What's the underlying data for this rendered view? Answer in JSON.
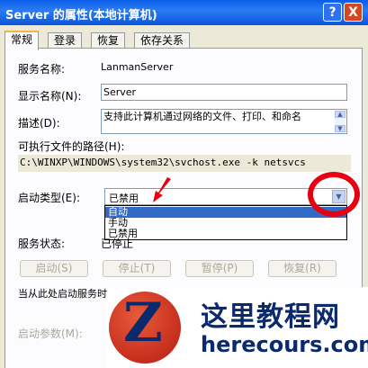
{
  "window": {
    "title": "Server 的属性(本地计算机)",
    "help_label": "?",
    "close_label": "X"
  },
  "tabs": [
    "常规",
    "登录",
    "恢复",
    "依存关系"
  ],
  "general": {
    "service_name_label": "服务名称:",
    "service_name_value": "LanmanServer",
    "display_name_label": "显示名称(N):",
    "display_name_value": "Server",
    "description_label": "描述(D):",
    "description_value": "支持此计算机通过网络的文件、打印、和命名",
    "exe_path_label": "可执行文件的路径(H):",
    "exe_path_value": "C:\\WINXP\\WINDOWS\\system32\\svchost.exe -k netsvcs",
    "startup_type_label": "启动类型(E):",
    "startup_type_value": "已禁用",
    "startup_options": [
      "自动",
      "手动",
      "已禁用"
    ],
    "startup_selected_option": "自动",
    "service_status_label": "服务状态:",
    "service_status_value": "已停止",
    "buttons": {
      "start": "启动(S)",
      "stop": "停止(T)",
      "pause": "暂停(P)",
      "resume": "恢复(R)"
    },
    "hint_text": "当从此处启动服务时，您可指定所适用的启动参数。",
    "start_params_label": "启动参数(M):"
  },
  "watermark": {
    "logo_letter": "Z",
    "name": "这里教程网",
    "url": "herecours.com"
  },
  "colors": {
    "titlebar": "#0b55d9",
    "highlight_ring": "#e60012",
    "selection": "#316ac5",
    "dialog_bg": "#ece9d8"
  }
}
